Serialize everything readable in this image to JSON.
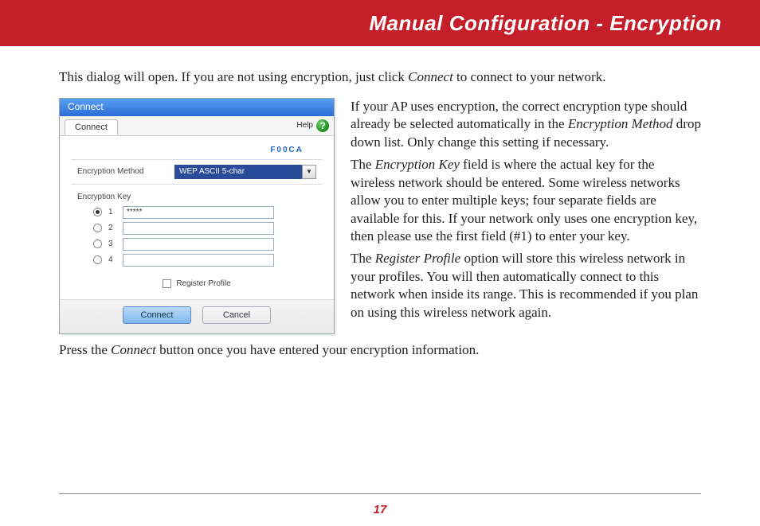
{
  "header": {
    "title": "Manual Configuration - Encryption"
  },
  "intro": {
    "text_a": "This dialog will open.  If you are not using encryption, just click ",
    "text_b_ital": "Connect",
    "text_c": " to connect to your network."
  },
  "dialog": {
    "titlebar": "Connect",
    "tab": "Connect",
    "help_label": "Help",
    "network_name": "F00CA",
    "enc_method_label": "Encryption Method",
    "enc_method_value": "WEP ASCII 5-char",
    "enc_key_label": "Encryption Key",
    "keys": [
      {
        "num": "1",
        "value": "*****",
        "selected": true
      },
      {
        "num": "2",
        "value": "",
        "selected": false
      },
      {
        "num": "3",
        "value": "",
        "selected": false
      },
      {
        "num": "4",
        "value": "",
        "selected": false
      }
    ],
    "register_label": "Register Profile",
    "connect_btn": "Connect",
    "cancel_btn": "Cancel"
  },
  "para1": {
    "a": "If your AP uses encryption, the correct encryption type should already be selected automatically in the ",
    "b_ital": "Encryption Method",
    "c": " drop down list.  Only change this setting if necessary."
  },
  "para2": {
    "a": "The ",
    "b_ital": "Encryption Key",
    "c": " field is where the actual key for the wireless network should be entered.  Some wireless networks allow you to enter multiple keys; four separate fields are available for this.  If your network only uses one encryption key, then please use the first field (#1) to enter your key."
  },
  "para3": {
    "a": "The ",
    "b_ital": "Register Profile",
    "c": " option will store this wireless network in your profiles.  You will then automatically connect to this network when inside its range.  This is recommended if you plan on using this wireless network again."
  },
  "outro": {
    "a": "Press the ",
    "b_ital": "Connect",
    "c": " button once you have entered your encryption information."
  },
  "page_number": "17"
}
